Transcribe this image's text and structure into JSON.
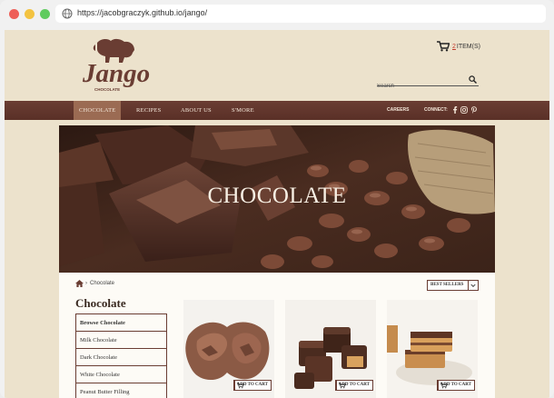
{
  "browser": {
    "url": "https://jacobgraczyk.github.io/jango/"
  },
  "logo": {
    "name": "Jango",
    "tagline": "CHOCOLATE"
  },
  "cart": {
    "count": "2",
    "label": "ITEM(S)"
  },
  "search": {
    "placeholder": "Search"
  },
  "nav": {
    "items": [
      {
        "label": "CHOCOLATE"
      },
      {
        "label": "RECIPES"
      },
      {
        "label": "ABOUT US"
      },
      {
        "label": "S'MORE"
      }
    ],
    "careers": "CAREERS",
    "connect": "CONNECT:"
  },
  "hero": {
    "title": "CHOCOLATE"
  },
  "breadcrumb": {
    "current": "Chocolate"
  },
  "sort": {
    "selected": "BEST SELLERS"
  },
  "sidebar": {
    "title": "Chocolate",
    "items": [
      {
        "label": "Browse Chocolate"
      },
      {
        "label": "Milk Chocolate"
      },
      {
        "label": "Dark Chocolate"
      },
      {
        "label": "White Chocolate"
      },
      {
        "label": "Peanut Butter Filling"
      }
    ]
  },
  "products": [
    {
      "add_label": "ADD TO CART"
    },
    {
      "add_label": "ADD TO CART"
    },
    {
      "add_label": "ADD TO CART"
    }
  ],
  "colors": {
    "nav": "#5a3027",
    "accent": "#c23a2b",
    "background": "#ece2cc"
  }
}
